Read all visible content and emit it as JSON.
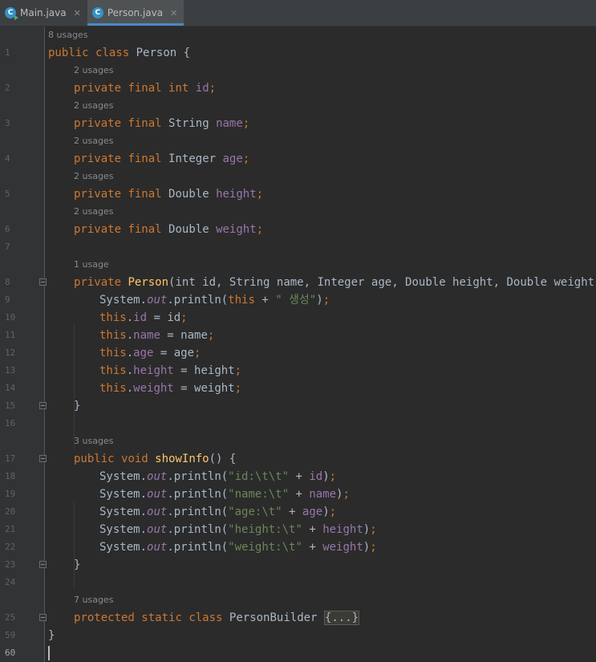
{
  "tabs": [
    {
      "label": "Main.java",
      "icon": "java-main-class-icon",
      "active": false
    },
    {
      "label": "Person.java",
      "icon": "java-class-icon",
      "active": true
    }
  ],
  "hints": {
    "class_usages": "8 usages",
    "field_usages": "2 usages",
    "ctor_usages": "1 usage",
    "method_usages": "3 usages",
    "builder_usages": "7 usages"
  },
  "line_numbers": [
    "1",
    "2",
    "3",
    "4",
    "5",
    "6",
    "7",
    "8",
    "9",
    "10",
    "11",
    "12",
    "13",
    "14",
    "15",
    "16",
    "17",
    "18",
    "19",
    "20",
    "21",
    "22",
    "23",
    "24",
    "25",
    "59",
    "60"
  ],
  "code": {
    "public": "public",
    "class": "class",
    "class_name": "Person",
    "private": "private",
    "final": "final",
    "int": "int",
    "fields": [
      "id",
      "name",
      "age",
      "height",
      "weight"
    ],
    "types": [
      "int",
      "String",
      "Integer",
      "Double",
      "Double"
    ],
    "ctor_name": "Person",
    "ctor_params": "int id, String name, Integer age, Double height, Double weight",
    "this": "this",
    "system": "System.",
    "out": "out",
    "println": ".println(",
    "created_str": "\" 생성\"",
    "method_void": "void",
    "method_name": "showInfo",
    "labels": [
      "\"id:\\t\\t\"",
      "\"name:\\t\"",
      "\"age:\\t\"",
      "\"height:\\t\"",
      "\"weight:\\t\""
    ],
    "protected": "protected",
    "static": "static",
    "builder_name": "PersonBuilder",
    "folded": "{...}"
  },
  "colors": {
    "background": "#2b2b2b",
    "keyword": "#cc7832",
    "field": "#9876aa",
    "method": "#ffc66d",
    "string": "#6a8759",
    "text": "#a9b7c6"
  }
}
